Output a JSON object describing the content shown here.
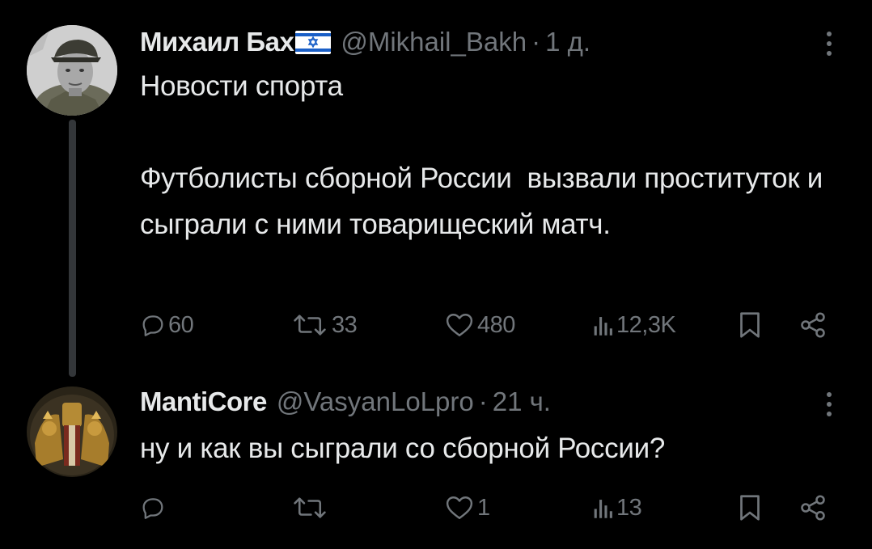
{
  "tweets": [
    {
      "author": "Михаил Бах",
      "author_flag": "israel-flag",
      "handle": "@Mikhail_Bakh",
      "separator": "·",
      "time": "1 д.",
      "text": "Новости спорта\n\nФутболисты сборной России  вызвали проституток и сыграли с ними товарищеский матч.",
      "stats": {
        "replies": "60",
        "retweets": "33",
        "likes": "480",
        "views": "12,3K"
      }
    },
    {
      "author": "MantiCore",
      "handle": "@VasyanLoLpro",
      "separator": "·",
      "time": "21 ч.",
      "text": "ну и как вы сыграли со сборной России?",
      "stats": {
        "replies": "",
        "retweets": "",
        "likes": "1",
        "views": "13"
      }
    }
  ],
  "colors": {
    "background": "#000000",
    "text": "#e7e9ea",
    "muted": "#71767b",
    "thread_line": "#333639"
  }
}
